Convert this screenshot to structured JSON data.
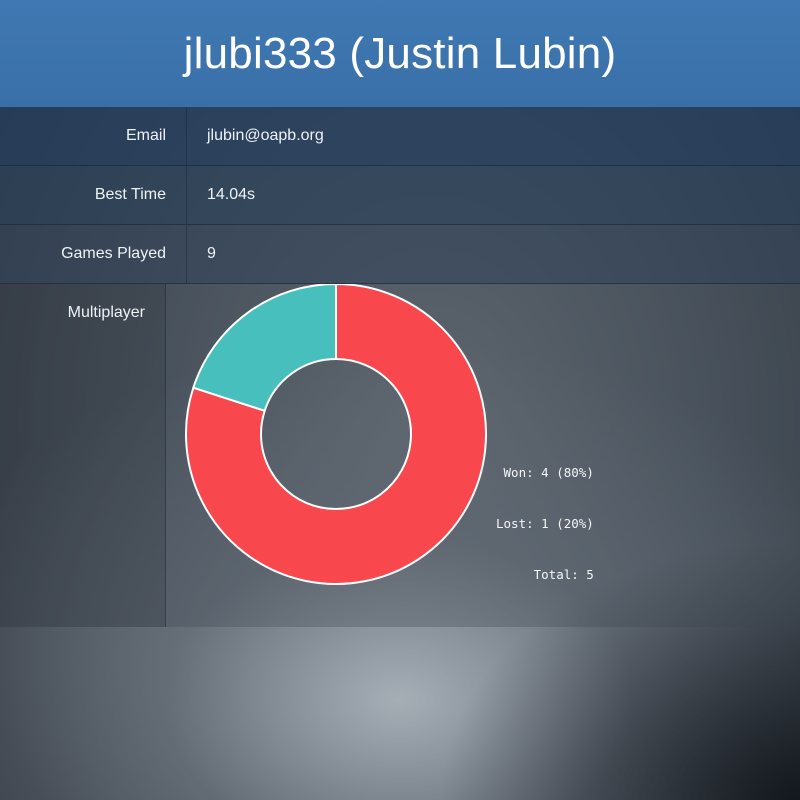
{
  "header": {
    "title": "jlubi333 (Justin Lubin)"
  },
  "profile": {
    "rows": [
      {
        "label": "Email",
        "value": "jlubin@oapb.org"
      },
      {
        "label": "Best Time",
        "value": "14.04s"
      },
      {
        "label": "Games Played",
        "value": "9"
      }
    ],
    "multiplayer_label": "Multiplayer"
  },
  "stats": {
    "won": "Won: 4 (80%)",
    "lost": "Lost: 1 (20%)",
    "total": "Total: 5"
  },
  "chart_data": {
    "type": "pie",
    "donut": true,
    "categories": [
      "Won",
      "Lost"
    ],
    "values": [
      4,
      1
    ],
    "colors": [
      "#f8474d",
      "#47c0bd"
    ]
  }
}
